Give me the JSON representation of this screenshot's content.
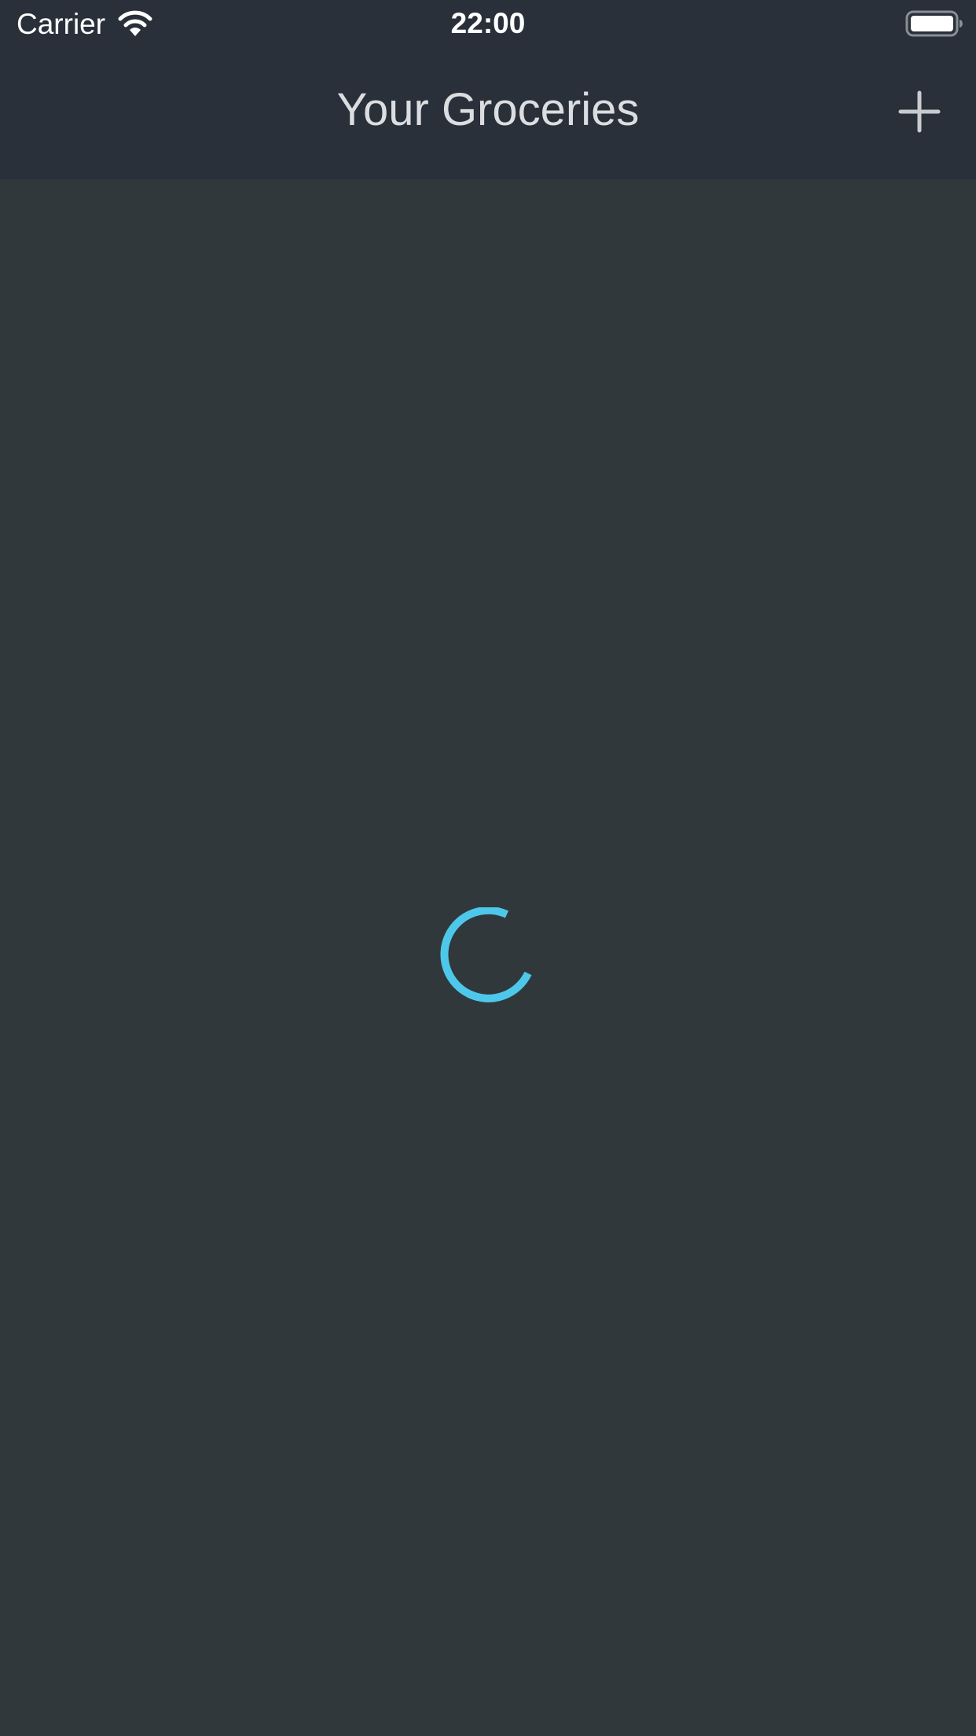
{
  "status_bar": {
    "carrier": "Carrier",
    "time": "22:00",
    "wifi_icon": "wifi-icon",
    "battery_icon": "battery-full-icon"
  },
  "nav_bar": {
    "title": "Your Groceries",
    "add_icon": "plus-icon"
  },
  "content": {
    "loading_indicator": "spinner-icon"
  },
  "colors": {
    "background": "#31383b",
    "header_background": "#29303a",
    "title_text": "#dcdde0",
    "accent": "#4dc8ea",
    "status_text": "#ffffff"
  }
}
